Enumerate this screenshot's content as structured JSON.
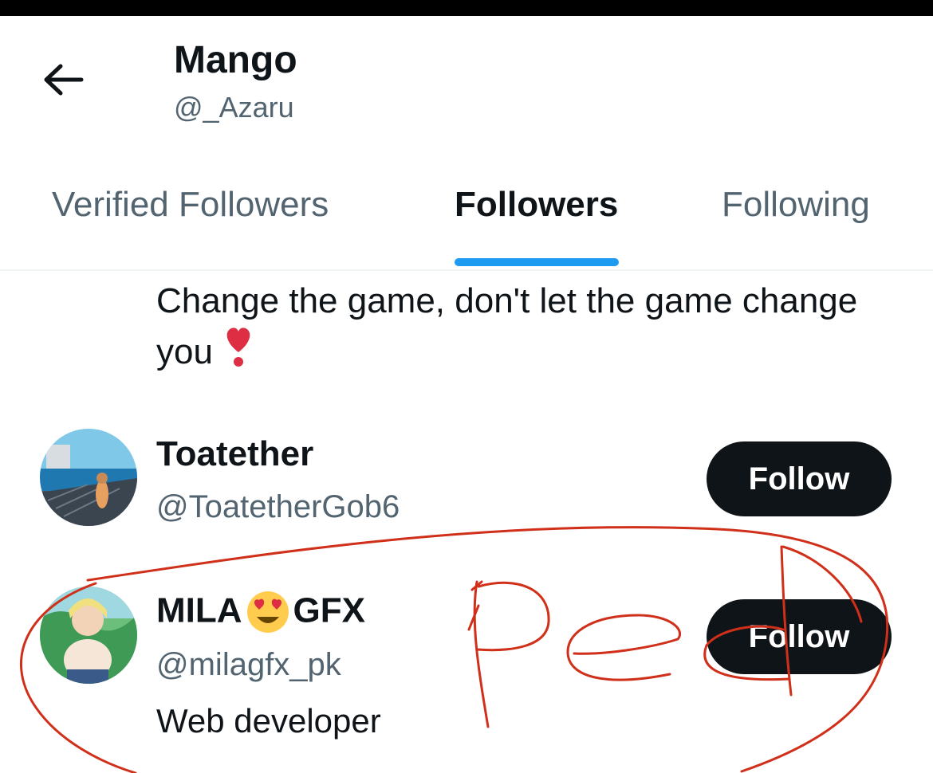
{
  "header": {
    "back_icon": "arrow-left-icon",
    "title": "Mango",
    "handle": "@_Azaru"
  },
  "tabs": [
    {
      "label": "Verified Followers",
      "active": false
    },
    {
      "label": "Followers",
      "active": true
    },
    {
      "label": "Following",
      "active": false
    }
  ],
  "previous_bio": {
    "text": "Change the game, don't let the game change you",
    "emoji": "heavy-heart-exclamation-icon"
  },
  "followers": [
    {
      "name": "Toatether",
      "handle": "@ToatetherGob6",
      "bio": "",
      "button": "Follow"
    },
    {
      "name_part1": "MILA",
      "emoji": "heart-eyes-emoji-icon",
      "name_part2": "GFX",
      "handle": "@milagfx_pk",
      "bio": "Web developer",
      "button": "Follow"
    }
  ],
  "colors": {
    "accent": "#1d9bf0",
    "button_bg": "#0f1419",
    "secondary_text": "#536471",
    "annotation": "#d0301a"
  }
}
